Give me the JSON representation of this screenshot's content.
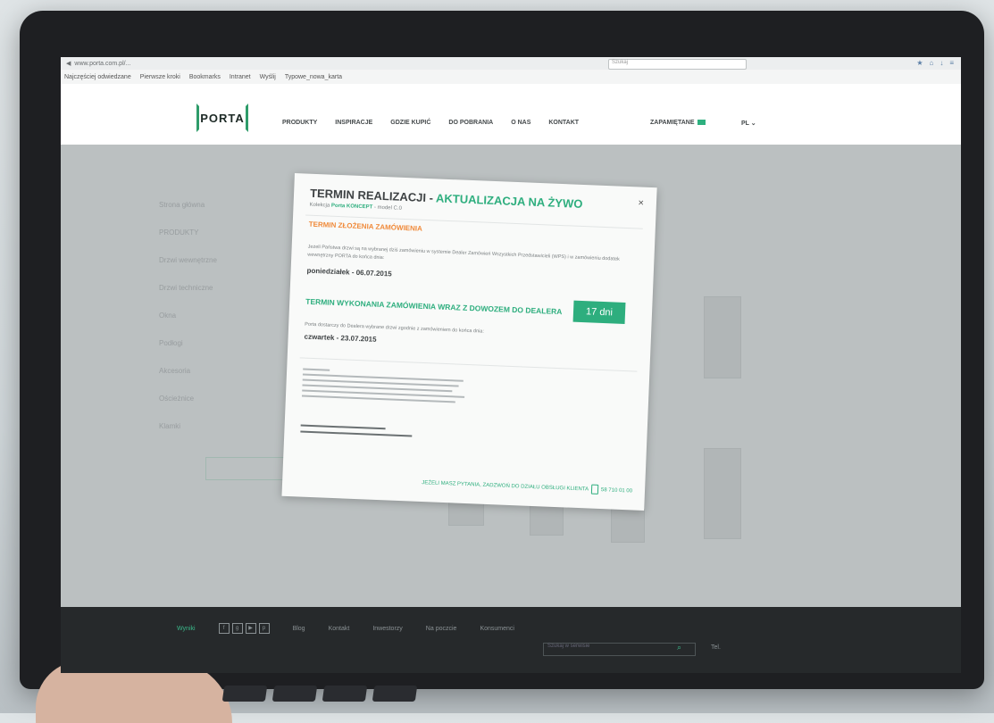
{
  "browser": {
    "url_text": "www.porta.com.pl/...",
    "search_placeholder": "Szukaj",
    "bookmarks": [
      "Najczęściej odwiedzane",
      "Pierwsze kroki",
      "Bookmarks",
      "Intranet",
      "Wyślij",
      "Typowe_nowa_karta"
    ]
  },
  "header": {
    "logo": "PORTA",
    "nav": [
      "PRODUKTY",
      "INSPIRACJE",
      "GDZIE KUPIĆ",
      "DO POBRANIA",
      "O NAS",
      "KONTAKT"
    ],
    "zapamietane": "ZAPAMIĘTANE",
    "lang": "PL"
  },
  "background": {
    "breadcrumb": "Strona główna",
    "side_title": "PRODUKTY",
    "side_items": [
      "Drzwi wewnętrzne",
      "Drzwi techniczne",
      "Okna",
      "Podłogi",
      "Akcesoria",
      "Ościeżnice",
      "Klamki"
    ]
  },
  "modal": {
    "title": "TERMIN REALIZACJI - ",
    "title_highlight": "AKTUALIZACJA NA ŻYWO",
    "subtitle_prefix": "Kolekcja ",
    "subtitle_product": "Porta KONCEPT",
    "subtitle_suffix": " - model C.0",
    "close": "×",
    "order_heading": "TERMIN ZŁOŻENIA ZAMÓWIENIA",
    "order_text": "Jeżeli Państwa drzwi są na wybranej dziś zamówieniu w systemie Dealer Zamówień Wszystkich Przedstawicieli (WPS) i w zamówieniu dodatek wewnętrzny PORTA do końca dnia:",
    "order_date": "poniedziałek - 06.07.2015",
    "delivery_heading": "TERMIN WYKONANIA ZAMÓWIENIA WRAZ Z DOWOZEM DO DEALERA",
    "delivery_days": "17 dni",
    "delivery_text": "Porta dostarczy do Dealera wybrane drzwi zgodnie z zamówieniem do końca dnia:",
    "delivery_date": "czwartek - 23.07.2015",
    "contact": "JEŻELI MASZ PYTANIA, ZADZWOŃ DO DZIAŁU OBSŁUGI KLIENTA",
    "phone": "58 710 01 00"
  },
  "footer": {
    "links": [
      "Blog",
      "Kontakt",
      "Inwestorzy",
      "Na poczcie",
      "Konsumenci"
    ],
    "active": "Wyniki",
    "search_placeholder": "Szukaj w serwisie",
    "tel": "Tel."
  }
}
